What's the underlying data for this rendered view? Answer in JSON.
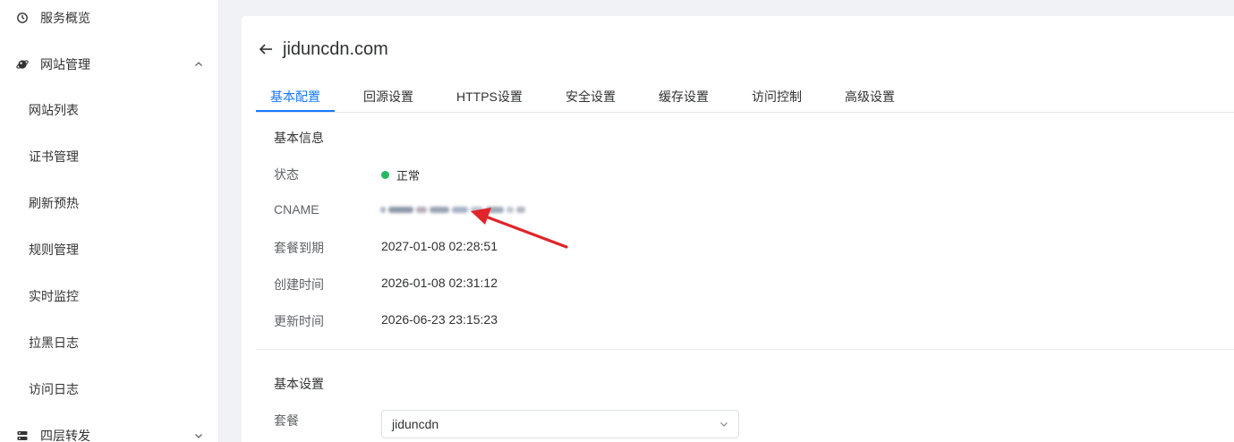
{
  "sidebar": {
    "groups": [
      {
        "label": "服务概览",
        "icon": "dashboard-icon"
      },
      {
        "label": "网站管理",
        "icon": "globe-icon",
        "expanded": true
      },
      {
        "label": "四层转发",
        "icon": "layers-icon",
        "expanded": false
      }
    ],
    "items": [
      {
        "label": "网站列表"
      },
      {
        "label": "证书管理"
      },
      {
        "label": "刷新预热"
      },
      {
        "label": "规则管理"
      },
      {
        "label": "实时监控"
      },
      {
        "label": "拉黑日志"
      },
      {
        "label": "访问日志"
      }
    ]
  },
  "main": {
    "title": "jiduncdn.com",
    "tabs": [
      {
        "label": "基本配置",
        "active": true
      },
      {
        "label": "回源设置"
      },
      {
        "label": "HTTPS设置"
      },
      {
        "label": "安全设置"
      },
      {
        "label": "缓存设置"
      },
      {
        "label": "访问控制"
      },
      {
        "label": "高级设置"
      }
    ],
    "basic_info": {
      "section_title": "基本信息",
      "rows": [
        {
          "label": "状态",
          "value": "正常",
          "status_color": "#25b864"
        },
        {
          "label": "CNAME",
          "value": ""
        },
        {
          "label": "套餐到期",
          "value": "2027-01-08 02:28:51"
        },
        {
          "label": "创建时间",
          "value": "2026-01-08 02:31:12"
        },
        {
          "label": "更新时间",
          "value": "2026-06-23 23:15:23"
        }
      ]
    },
    "basic_settings": {
      "section_title": "基本设置",
      "plan_label": "套餐",
      "plan_value": "jiduncdn"
    }
  },
  "colors": {
    "accent": "#1677ff",
    "status_ok": "#25b864",
    "annotation_arrow": "#e0242a"
  }
}
